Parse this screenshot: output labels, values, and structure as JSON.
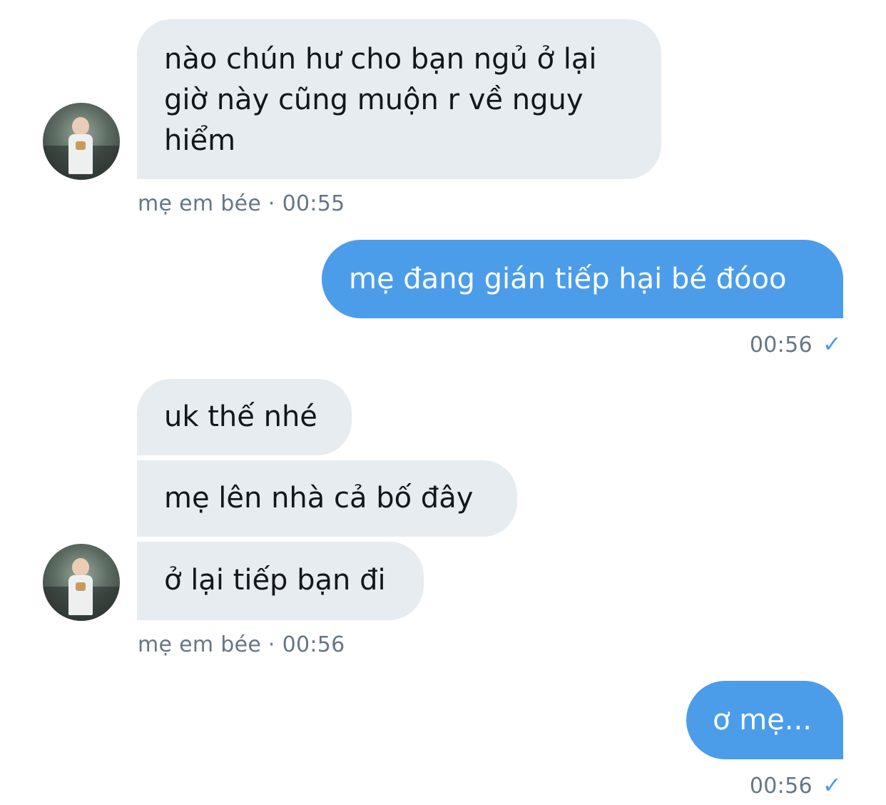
{
  "contact": {
    "name": "mẹ em bée",
    "avatar_icon": "contact-avatar"
  },
  "messages": [
    {
      "from": "other",
      "lines": [
        "nào chún hư cho bạn ngủ ở lại",
        "giờ này cũng muộn r về nguy",
        "hiểm"
      ]
    },
    {
      "from": "other",
      "meta": "mẹ em bée · 00:55"
    },
    {
      "from": "me",
      "text": "mẹ đang gián tiếp hại bé đóoo",
      "time": "00:56"
    },
    {
      "from": "other",
      "text": "uk thế nhé"
    },
    {
      "from": "other",
      "text": "mẹ lên nhà cả bố đây"
    },
    {
      "from": "other",
      "text": "ở lại tiếp bạn đi"
    },
    {
      "from": "other",
      "meta": "mẹ em bée · 00:56"
    },
    {
      "from": "me",
      "text": "ơ mẹ...",
      "time": "00:56"
    }
  ],
  "colors": {
    "sent_bubble": "#4b9de9",
    "received_bubble": "#e6ecf0",
    "meta_text": "#657786",
    "check": "#4b9de9"
  },
  "icons": {
    "read_receipt": "checkmark-icon"
  }
}
